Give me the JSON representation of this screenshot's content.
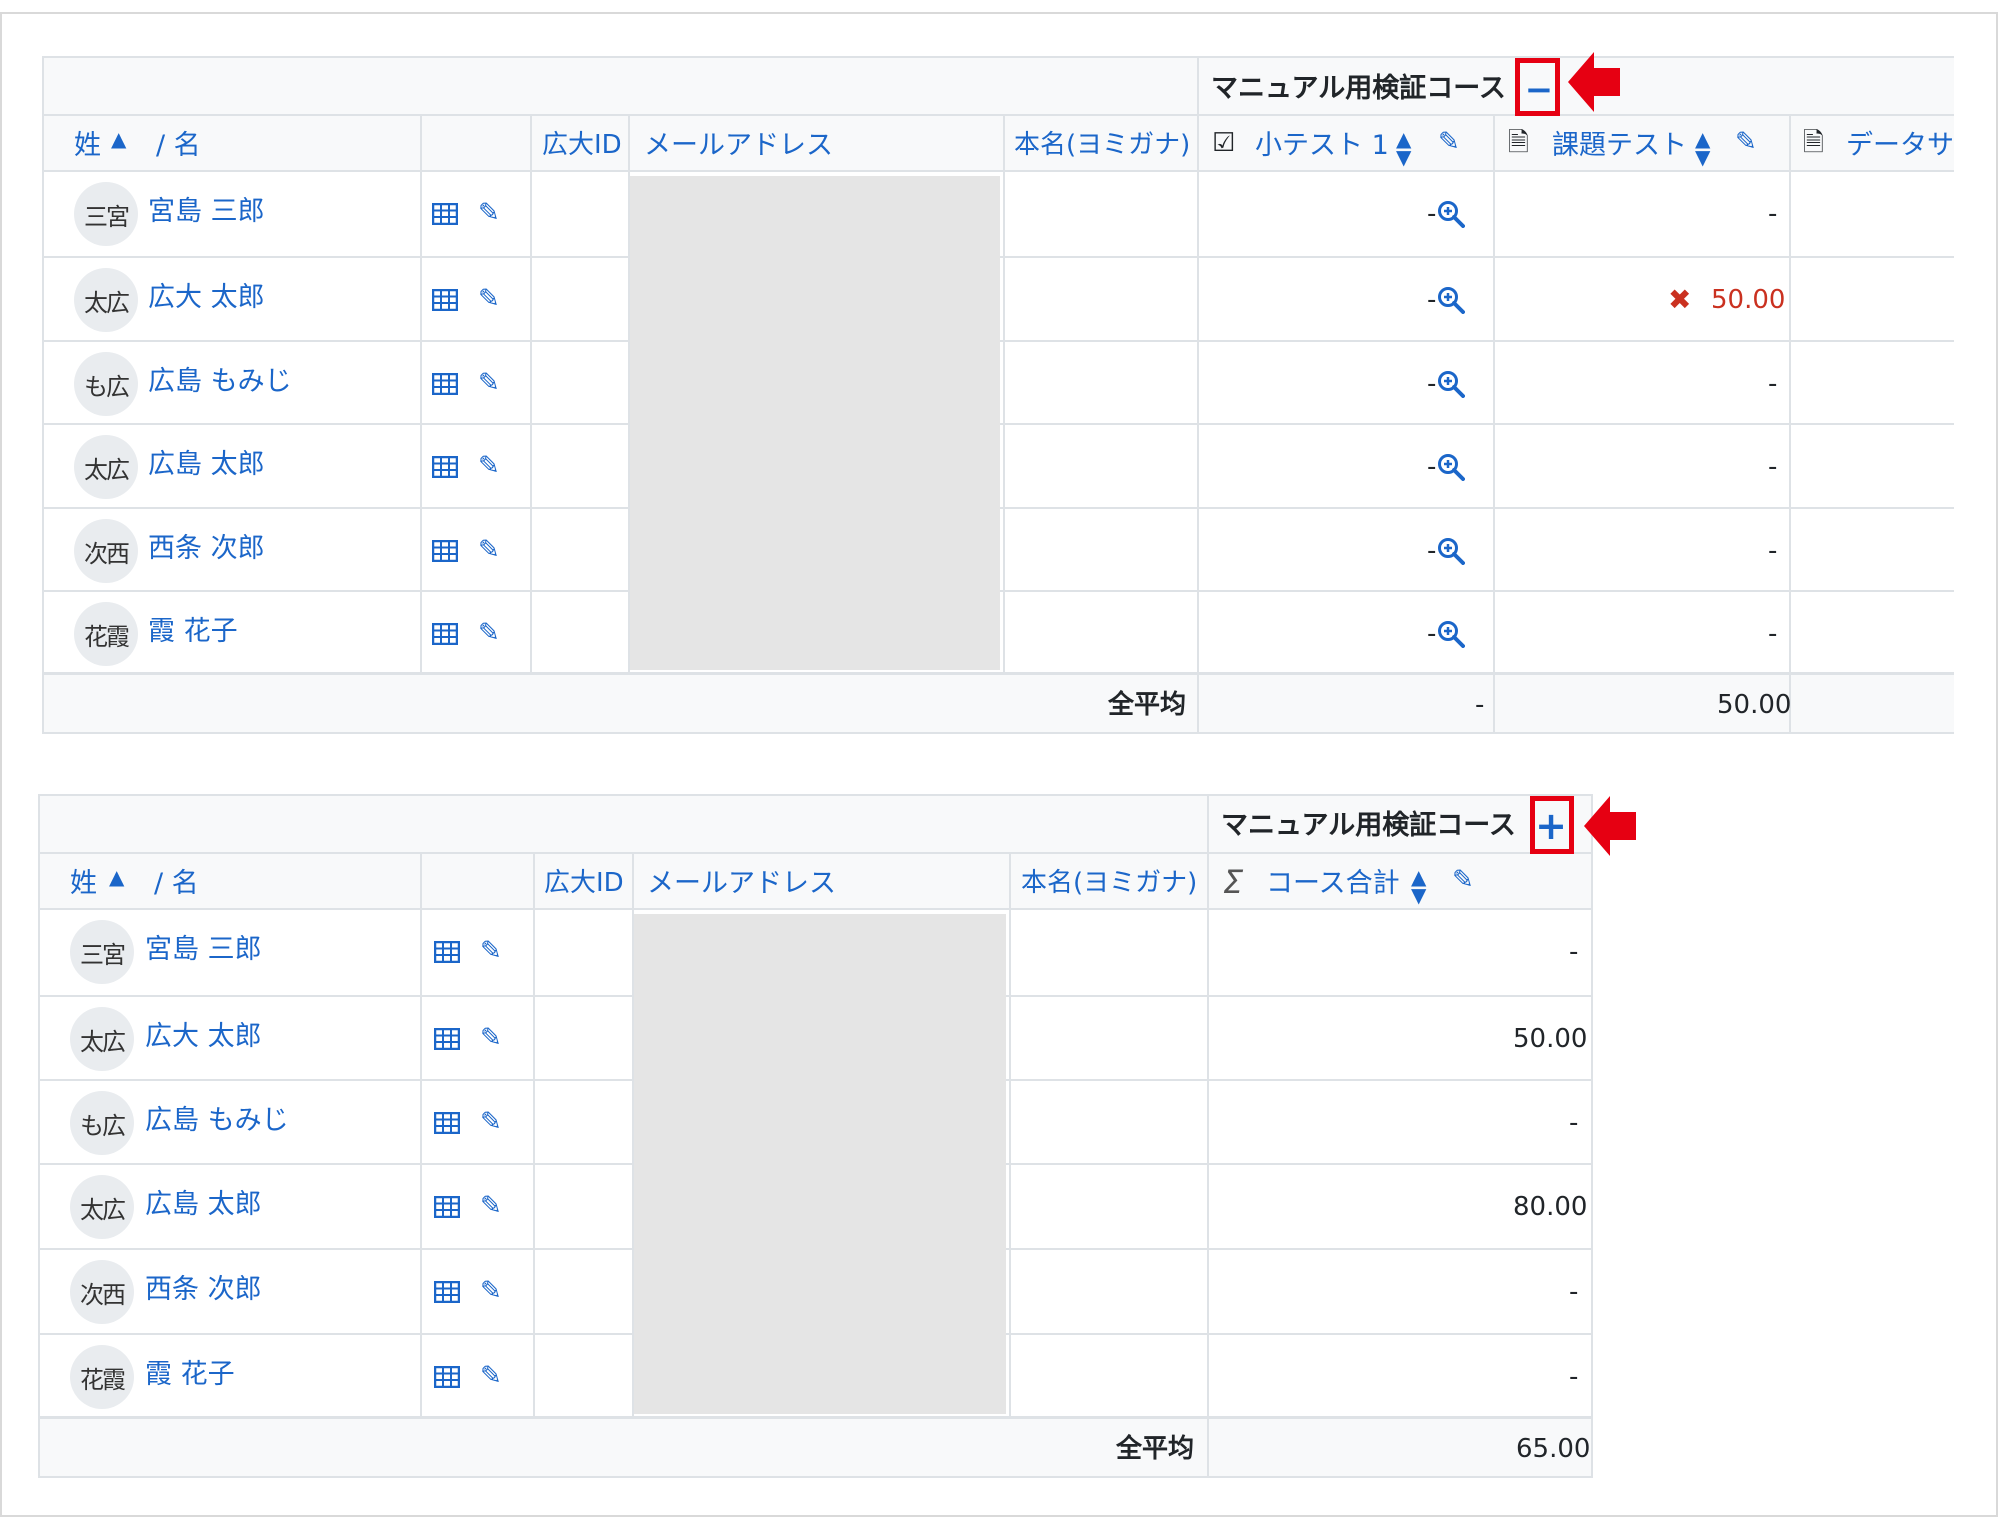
{
  "course_label": "マニュアル用検証コース",
  "headers": {
    "surname": "姓",
    "slash_name": "/ 名",
    "id": "広大ID",
    "email": "メールアドレス",
    "kana": "本名(ヨミガナ)"
  },
  "top_table": {
    "collapse_symbol": "−",
    "items": [
      {
        "label": "小テスト 1",
        "icon": "quiz-icon"
      },
      {
        "label": "課題テスト",
        "icon": "assignment-icon"
      },
      {
        "label": "データサ",
        "icon": "assignment-icon"
      }
    ],
    "rows": [
      {
        "initials": "三宮",
        "name": "宮島 三郎",
        "quiz": "-",
        "assign": "-",
        "assign_fail": false
      },
      {
        "initials": "太広",
        "name": "広大 太郎",
        "quiz": "-",
        "assign": "50.00",
        "assign_fail": true
      },
      {
        "initials": "も広",
        "name": "広島 もみじ",
        "quiz": "-",
        "assign": "-",
        "assign_fail": false
      },
      {
        "initials": "太広",
        "name": "広島 太郎",
        "quiz": "-",
        "assign": "-",
        "assign_fail": false
      },
      {
        "initials": "次西",
        "name": "西条 次郎",
        "quiz": "-",
        "assign": "-",
        "assign_fail": false
      },
      {
        "initials": "花霞",
        "name": "霞 花子",
        "quiz": "-",
        "assign": "-",
        "assign_fail": false
      }
    ],
    "avg_label": "全平均",
    "avg_quiz": "-",
    "avg_assign": "50.00"
  },
  "bottom_table": {
    "expand_symbol": "+",
    "total_label": "コース合計",
    "sigma": "Σ",
    "rows": [
      {
        "initials": "三宮",
        "name": "宮島 三郎",
        "total": "-"
      },
      {
        "initials": "太広",
        "name": "広大 太郎",
        "total": "50.00"
      },
      {
        "initials": "も広",
        "name": "広島 もみじ",
        "total": "-"
      },
      {
        "initials": "太広",
        "name": "広島 太郎",
        "total": "80.00"
      },
      {
        "initials": "次西",
        "name": "西条 次郎",
        "total": "-"
      },
      {
        "initials": "花霞",
        "name": "霞 花子",
        "total": "-"
      }
    ],
    "avg_label": "全平均",
    "avg_total": "65.00"
  },
  "colors": {
    "link": "#1b66c9",
    "fail": "#ca3120",
    "annotation": "#e60012"
  }
}
